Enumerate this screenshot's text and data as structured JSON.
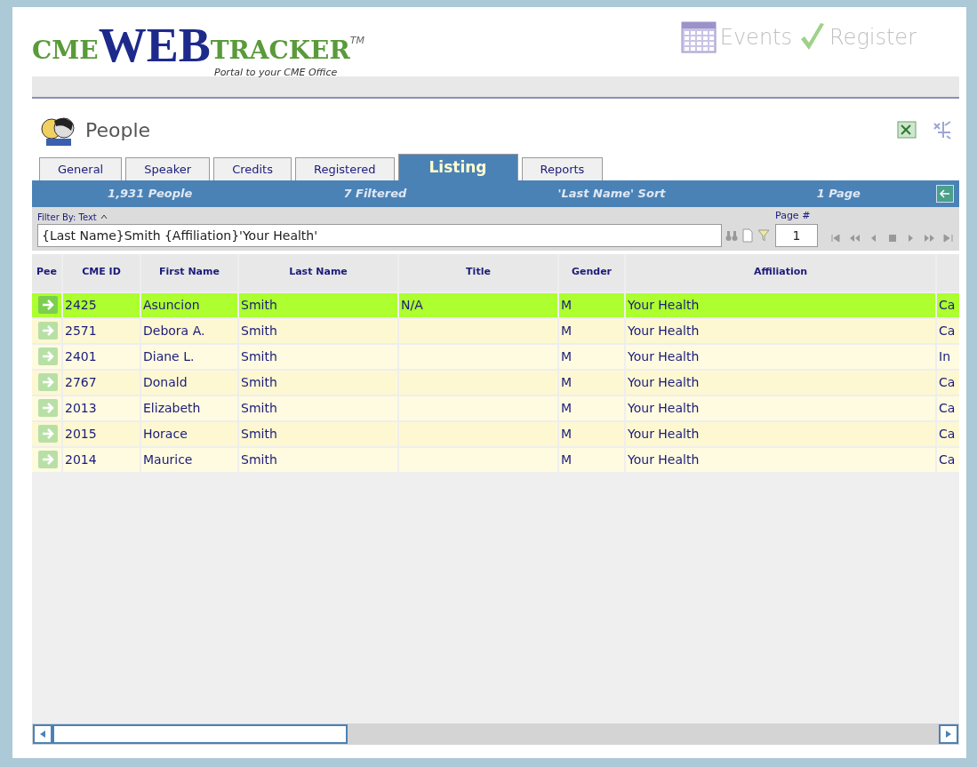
{
  "logo": {
    "cme": "CME",
    "web": "WEB",
    "tracker": "TRACKER",
    "tm": "TM",
    "tagline": "Portal to your CME Office"
  },
  "top_links": [
    {
      "kind": "calendar",
      "label": "Events"
    },
    {
      "kind": "check",
      "label": "Register"
    }
  ],
  "page_title": "People",
  "tabs": [
    {
      "label": "General",
      "selected": false
    },
    {
      "label": "Speaker",
      "selected": false
    },
    {
      "label": "Credits",
      "selected": false
    },
    {
      "label": "Registered",
      "selected": false
    },
    {
      "label": "Listing",
      "selected": true
    },
    {
      "label": "Reports",
      "selected": false
    }
  ],
  "summary": [
    "1,931 People",
    "7 Filtered",
    "'Last Name' Sort",
    "1 Page"
  ],
  "filter": {
    "label": "Filter By: Text",
    "value": "{Last Name}Smith {Affiliation}'Your Health'"
  },
  "page": {
    "label": "Page #",
    "value": "1"
  },
  "table": {
    "columns": [
      "Pee",
      "CME ID",
      "First Name",
      "Last Name",
      "Title",
      "Gender",
      "Affiliation",
      ""
    ],
    "rows": [
      {
        "selected": true,
        "cells": [
          "",
          "2425",
          "Asuncion",
          "Smith",
          "N/A",
          "M",
          "Your Health",
          "Ca"
        ]
      },
      {
        "selected": false,
        "cells": [
          "",
          "2571",
          "Debora A.",
          "Smith",
          "",
          "M",
          "Your Health",
          "Ca"
        ]
      },
      {
        "selected": false,
        "cells": [
          "",
          "2401",
          "Diane L.",
          "Smith",
          "",
          "M",
          "Your Health",
          "In"
        ]
      },
      {
        "selected": false,
        "cells": [
          "",
          "2767",
          "Donald",
          "Smith",
          "",
          "M",
          "Your Health",
          "Ca"
        ]
      },
      {
        "selected": false,
        "cells": [
          "",
          "2013",
          "Elizabeth",
          "Smith",
          "",
          "M",
          "Your Health",
          "Ca"
        ]
      },
      {
        "selected": false,
        "cells": [
          "",
          "2015",
          "Horace",
          "Smith",
          "",
          "M",
          "Your Health",
          "Ca"
        ]
      },
      {
        "selected": false,
        "cells": [
          "",
          "2014",
          "Maurice",
          "Smith",
          "",
          "M",
          "Your Health",
          "Ca"
        ]
      }
    ]
  }
}
